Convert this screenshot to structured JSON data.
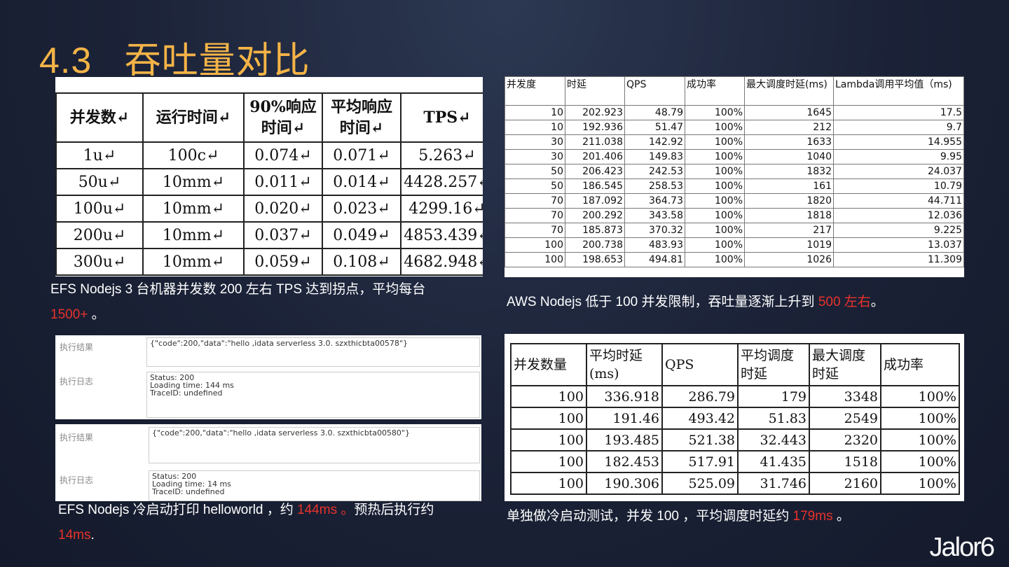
{
  "title": "4.3   吞吐量对比",
  "table1": {
    "headers": [
      "并发数↵",
      "运行时间↵",
      "90%响应时间↵",
      "平均响应时间↵",
      "TPS↵"
    ],
    "rows": [
      [
        "1u↵",
        "100c↵",
        "0.074↵",
        "0.071↵",
        "5.263↵"
      ],
      [
        "50u↵",
        "10mm↵",
        "0.011↵",
        "0.014↵",
        "4428.257↵"
      ],
      [
        "100u↵",
        "10mm↵",
        "0.020↵",
        "0.023↵",
        "4299.16↵"
      ],
      [
        "200u↵",
        "10mm↵",
        "0.037↵",
        "0.049↵",
        "4853.439↵"
      ],
      [
        "300u↵",
        "10mm↵",
        "0.059↵",
        "0.108↵",
        "4682.948↵"
      ]
    ]
  },
  "caption1": {
    "text": "EFS Nodejs 3 台机器并发数 200 左右 TPS 达到拐点，平均每台",
    "red": "1500+",
    "tail": " 。"
  },
  "table2": {
    "headers": [
      "并发度",
      "时延",
      "QPS",
      "成功率",
      "最大调度时延(ms)",
      "Lambda调用平均值（ms)"
    ],
    "rows": [
      [
        "10",
        "202.923",
        "48.79",
        "100%",
        "1645",
        "17.5"
      ],
      [
        "10",
        "192.936",
        "51.47",
        "100%",
        "212",
        "9.7"
      ],
      [
        "30",
        "211.038",
        "142.92",
        "100%",
        "1633",
        "14.955"
      ],
      [
        "30",
        "201.406",
        "149.83",
        "100%",
        "1040",
        "9.95"
      ],
      [
        "50",
        "206.423",
        "242.53",
        "100%",
        "1832",
        "24.037"
      ],
      [
        "50",
        "186.545",
        "258.53",
        "100%",
        "161",
        "10.79"
      ],
      [
        "70",
        "187.092",
        "364.73",
        "100%",
        "1820",
        "44.711"
      ],
      [
        "70",
        "200.292",
        "343.58",
        "100%",
        "1818",
        "12.036"
      ],
      [
        "70",
        "185.873",
        "370.32",
        "100%",
        "217",
        "9.225"
      ],
      [
        "100",
        "200.738",
        "483.93",
        "100%",
        "1019",
        "13.037"
      ],
      [
        "100",
        "198.653",
        "494.81",
        "100%",
        "1026",
        "11.309"
      ]
    ]
  },
  "caption2": {
    "text": "AWS Nodejs 低于 100 并发限制，吞吐量逐渐上升到 ",
    "red": "500 左右",
    "tail": "。"
  },
  "shot1": {
    "result_label": "执行结果",
    "result": "{\"code\":200,\"data\":\"hello ,idata serverless 3.0. szxthicbta00578\"}",
    "log_label": "执行日志",
    "log": [
      "Status: 200",
      "Loading time: 144 ms",
      "TraceID: undefined"
    ]
  },
  "shot2": {
    "result_label": "执行结果",
    "result": "{\"code\":200,\"data\":\"hello ,idata serverless 3.0. szxthicbta00580\"}",
    "log_label": "执行日志",
    "log": [
      "Status: 200",
      "Loading time: 14 ms",
      "TraceID: undefined"
    ]
  },
  "caption3": {
    "text": "EFS Nodejs  冷启动打印 helloworld  ，约 ",
    "red": "144ms 。",
    "mid": "预热后执行约",
    "red2": "14ms",
    "tail": "."
  },
  "table3": {
    "headers": [
      "并发数量",
      "平均时延(ms)",
      "QPS",
      "平均调度时延",
      "最大调度时延",
      "成功率"
    ],
    "rows": [
      [
        "100",
        "336.918",
        "286.79",
        "179",
        "3348",
        "100%"
      ],
      [
        "100",
        "191.46",
        "493.42",
        "51.83",
        "2549",
        "100%"
      ],
      [
        "100",
        "193.485",
        "521.38",
        "32.443",
        "2320",
        "100%"
      ],
      [
        "100",
        "182.453",
        "517.91",
        "41.435",
        "1518",
        "100%"
      ],
      [
        "100",
        "190.306",
        "525.09",
        "31.746",
        "2160",
        "100%"
      ]
    ]
  },
  "caption4": {
    "text": "单独做冷启动测试，并发 100  ，平均调度时延约 ",
    "red": "179ms",
    "tail": " 。"
  },
  "logo": "Jalor6"
}
